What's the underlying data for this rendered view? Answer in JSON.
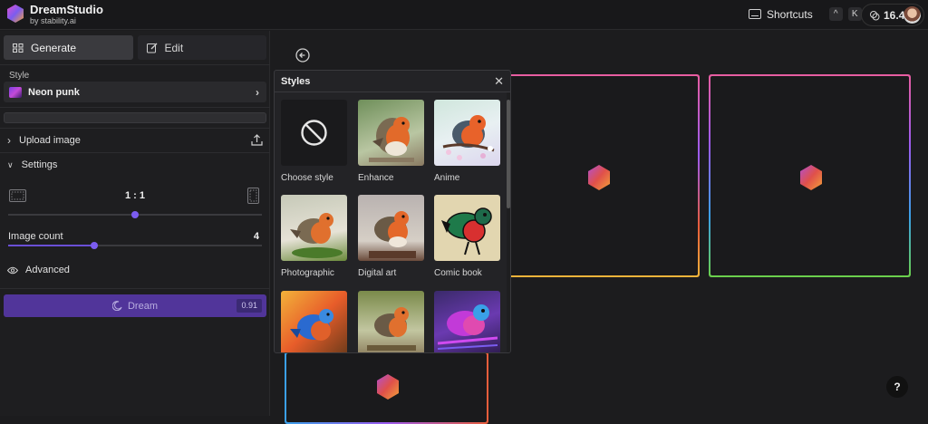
{
  "header": {
    "app_name": "DreamStudio",
    "app_by": "by stability.ai",
    "shortcuts_label": "Shortcuts",
    "shortcut_keys": [
      "^",
      "K"
    ],
    "credits": "16.4"
  },
  "sidebar": {
    "tabs": [
      {
        "label": "Generate",
        "icon": "grid-icon",
        "active": true
      },
      {
        "label": "Edit",
        "icon": "edit-icon",
        "active": false
      }
    ],
    "style_label": "Style",
    "style_value": "Neon punk",
    "prompt_value": "",
    "upload_label": "Upload image",
    "settings_label": "Settings",
    "aspect_ratio": "1 : 1",
    "aspect_ratio_position": 0.5,
    "image_count_label": "Image count",
    "image_count_value": "4",
    "image_count_position": 0.34,
    "advanced_label": "Advanced",
    "dream_label": "Dream",
    "dream_cost": "0.91"
  },
  "styles_panel": {
    "title": "Styles",
    "items": [
      {
        "label": "Choose style"
      },
      {
        "label": "Enhance"
      },
      {
        "label": "Anime"
      },
      {
        "label": "Photographic"
      },
      {
        "label": "Digital art"
      },
      {
        "label": "Comic book"
      },
      {
        "label": ""
      },
      {
        "label": ""
      },
      {
        "label": ""
      }
    ]
  },
  "canvas": {
    "help_label": "?",
    "accent_colors": [
      "#7b5cf0",
      "#e85d3a",
      "#3aa0e8",
      "#6bd04a"
    ]
  }
}
